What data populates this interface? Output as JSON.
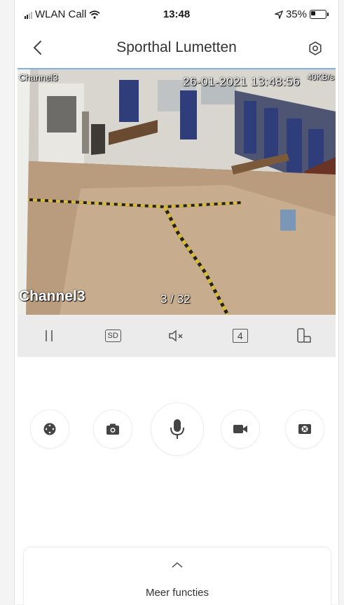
{
  "status_bar": {
    "carrier": "WLAN Call",
    "time": "13:48",
    "battery": "35%"
  },
  "header": {
    "title": "Sporthal Lumetten"
  },
  "video": {
    "channel_top": "Channel3",
    "timestamp": "26-01-2021 13:48:56",
    "bitrate": "40KB/s",
    "channel_bottom": "Channel3",
    "page": "3 / 32"
  },
  "controls": {
    "quality": "SD",
    "split": "4"
  },
  "icons": {
    "back": "chevron-left-icon",
    "settings": "settings-icon",
    "pause": "pause-icon",
    "mute": "speaker-muted-icon",
    "rotate": "rotate-screen-icon",
    "ptz": "ptz-joystick-icon",
    "snapshot": "camera-icon",
    "talk": "microphone-icon",
    "record": "video-camera-icon",
    "fisheye": "fisheye-icon",
    "more": "chevron-up-icon"
  },
  "more_functions": {
    "label": "Meer functies"
  },
  "colors": {
    "accent_line": "#7fb2e6",
    "controls_bg": "#ebebeb",
    "icon": "#444444"
  }
}
